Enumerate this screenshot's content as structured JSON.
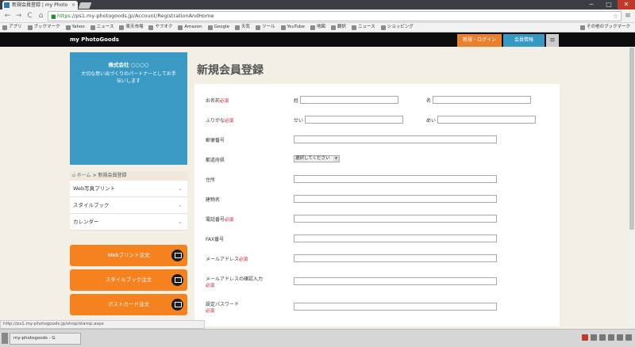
{
  "browser": {
    "tab_title": "新規会員登録 | my Photo",
    "tab_close": "×",
    "url_scheme": "https",
    "url_rest": "://ps1.my-photogoods.jp/Account/RegistrationAndHome",
    "back": "←",
    "forward": "→",
    "reload": "C",
    "home": "⌂",
    "star": "☆",
    "menu": "≡",
    "window_controls": [
      "─",
      "□",
      "✕"
    ],
    "bookmarks": [
      "アプリ",
      "ブックマーク",
      "Yahoo",
      "ニュース",
      "楽天市場",
      "ヤフオク",
      "Amazon",
      "Google",
      "天気",
      "ツール",
      "YouTube",
      "地図",
      "翻訳",
      "ニュース",
      "ショッピング",
      "その他のブックマーク"
    ],
    "status_url": "http://ps1.my-photogoods.jp/shop/stamp.aspx"
  },
  "site": {
    "brand": "my PhotoGoods",
    "login_label": "新規・ログイン",
    "member_label": "会員情報",
    "menu_icon": "≡"
  },
  "sidebar": {
    "banner_title": "株式会社 ○○○○",
    "banner_sub": "大切な思い出づくりのパートナーとしてお手伝いします",
    "breadcrumb_home": "ホーム",
    "breadcrumb_sep": ">",
    "breadcrumb_current": "新規会員登録",
    "menu": [
      {
        "label": "Web写真プリント"
      },
      {
        "label": "スタイルブック"
      },
      {
        "label": "カレンダー"
      }
    ],
    "chevron": "⌄",
    "order_buttons": [
      {
        "label": "Webプリント注文"
      },
      {
        "label": "スタイルブック注文"
      },
      {
        "label": "ポストカード注文"
      }
    ]
  },
  "form": {
    "title": "新規会員登録",
    "required_mark": "必須",
    "name_label": "お名前",
    "name_sei": "姓",
    "name_mei": "名",
    "kana_label": "ふりがな",
    "kana_sei": "せい",
    "kana_mei": "めい",
    "zip_label": "郵便番号",
    "pref_label": "都道府県",
    "pref_value": "選択してください",
    "address_label": "住所",
    "building_label": "建物名",
    "tel_label": "電話番号",
    "fax_label": "FAX番号",
    "email_label": "メールアドレス",
    "email_confirm_label": "メールアドレスの確認入力",
    "password_label": "設定パスワード",
    "select_arrow": "▾"
  },
  "taskbar": {
    "item_label": "my-photogoods - G"
  }
}
